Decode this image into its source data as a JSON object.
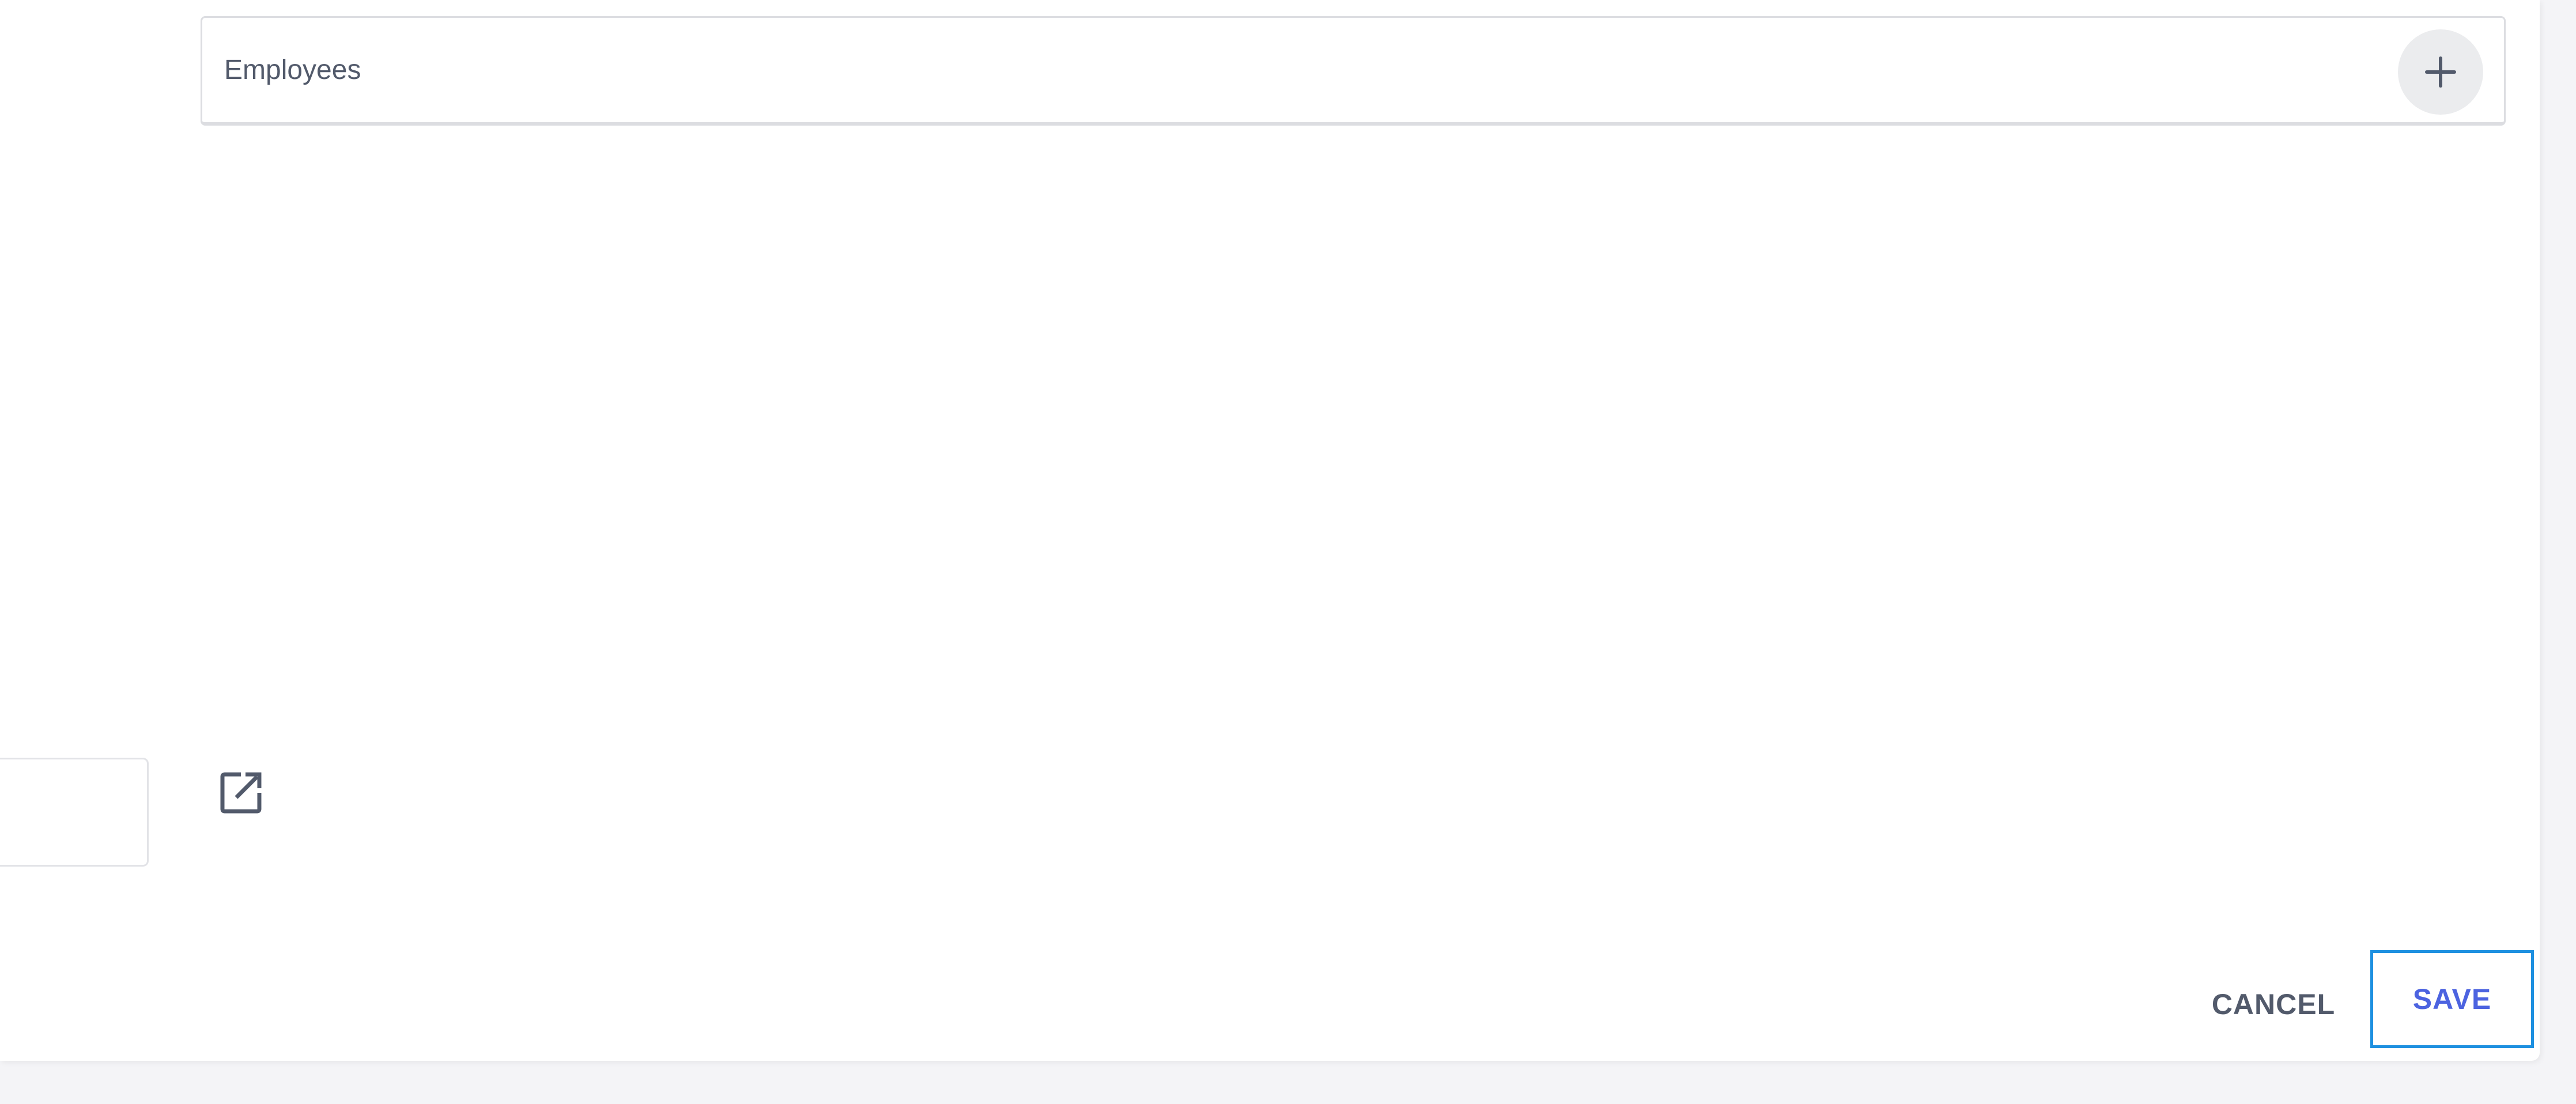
{
  "form": {
    "employees_label": "Employees",
    "add_icon": "plus-icon",
    "open_icon": "open-in-new-icon"
  },
  "footer": {
    "cancel_label": "CANCEL",
    "save_label": "SAVE"
  },
  "colors": {
    "text": "#525a6b",
    "accent": "#4c63e0",
    "focus_border": "#1e90e0",
    "page_bg": "#f4f4f7"
  }
}
